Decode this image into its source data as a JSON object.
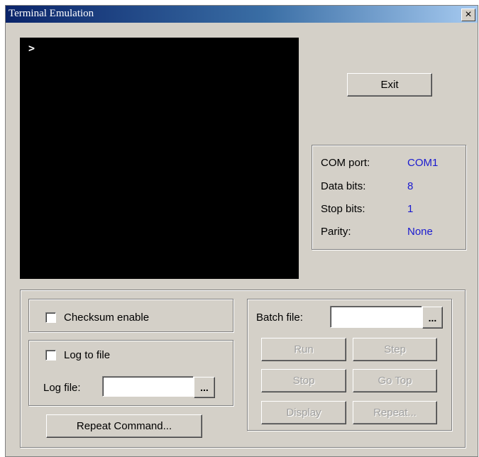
{
  "window": {
    "title": "Terminal Emulation",
    "close_label": "×"
  },
  "terminal": {
    "prompt": ">"
  },
  "exit_button": "Exit",
  "com_settings": [
    {
      "label": "COM port:",
      "value": "COM1"
    },
    {
      "label": "Data bits:",
      "value": "8"
    },
    {
      "label": "Stop bits:",
      "value": "1"
    },
    {
      "label": "Parity:",
      "value": "None"
    }
  ],
  "checksum": {
    "label": "Checksum enable",
    "checked": false
  },
  "log": {
    "checkbox_label": "Log to file",
    "checked": false,
    "file_label": "Log file:",
    "file_value": "",
    "browse": "..."
  },
  "repeat_command_button": "Repeat Command...",
  "batch": {
    "file_label": "Batch file:",
    "file_value": "",
    "browse": "...",
    "buttons": {
      "run": "Run",
      "step": "Step",
      "stop": "Stop",
      "go_top": "Go Top",
      "display": "Display",
      "repeat": "Repeat..."
    }
  }
}
